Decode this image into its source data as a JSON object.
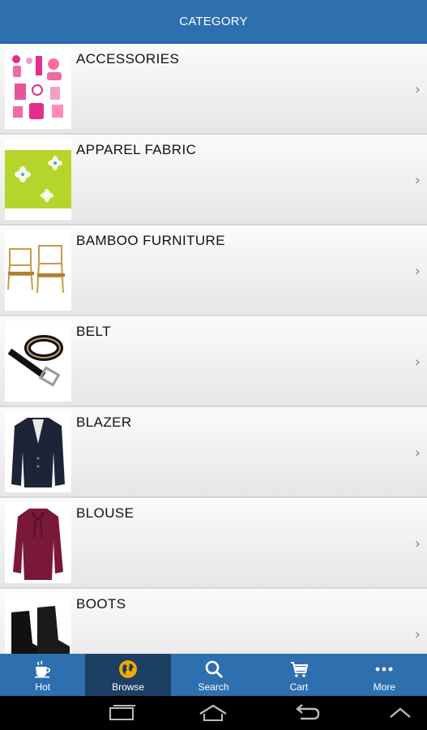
{
  "header": {
    "title": "CATEGORY"
  },
  "categories": [
    {
      "label": "ACCESSORIES"
    },
    {
      "label": "APPAREL FABRIC"
    },
    {
      "label": "BAMBOO FURNITURE"
    },
    {
      "label": "BELT"
    },
    {
      "label": "BLAZER"
    },
    {
      "label": "BLOUSE"
    },
    {
      "label": "BOOTS"
    }
  ],
  "tabs": [
    {
      "label": "Hot",
      "icon": "coffee-cup-icon"
    },
    {
      "label": "Browse",
      "icon": "globe-icon",
      "active": true
    },
    {
      "label": "Search",
      "icon": "magnifier-icon"
    },
    {
      "label": "Cart",
      "icon": "cart-icon"
    },
    {
      "label": "More",
      "icon": "more-dots-icon"
    }
  ],
  "system_nav": [
    "recent-apps-icon",
    "home-icon",
    "back-icon",
    "up-chevron-icon"
  ],
  "colors": {
    "bar": "#2e6fb0",
    "active_tab": "#1c3f63",
    "globe": "#f2a900"
  }
}
